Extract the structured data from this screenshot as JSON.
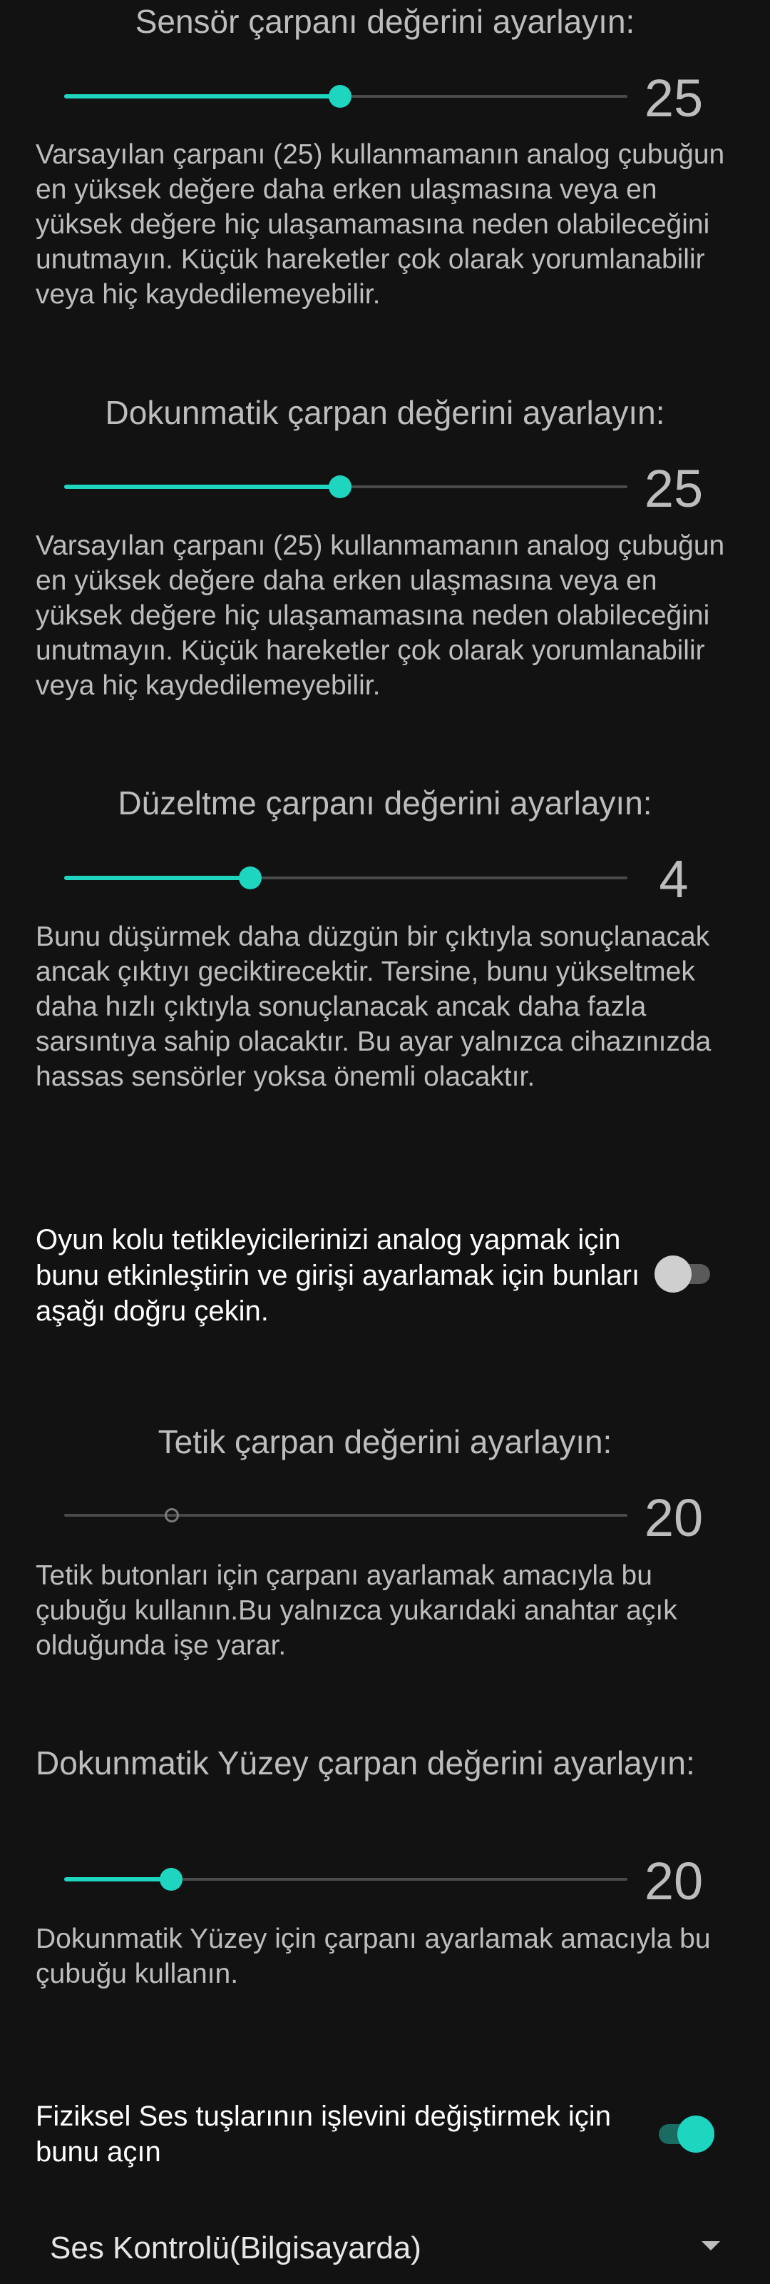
{
  "sensor_multiplier": {
    "title": "Sensör çarpanı değerini ayarlayın:",
    "value": "25",
    "slider_position": 0.49,
    "description": "Varsayılan çarpanı (25) kullanmamanın analog çubuğun en yüksek değere daha erken ulaşmasına veya en yüksek değere hiç ulaşamamasına neden olabileceğini unutmayın. Küçük hareketler çok olarak yorumlanabilir veya hiç kaydedilemeyebilir."
  },
  "touch_multiplier": {
    "title": "Dokunmatik çarpan değerini ayarlayın:",
    "value": "25",
    "slider_position": 0.49,
    "description": "Varsayılan çarpanı (25) kullanmamanın analog çubuğun en yüksek değere daha erken ulaşmasına veya en yüksek değere hiç ulaşamamasına neden olabileceğini unutmayın. Küçük hareketler çok olarak yorumlanabilir veya hiç kaydedilemeyebilir."
  },
  "smoothing_multiplier": {
    "title": "Düzeltme çarpanı değerini ayarlayın:",
    "value": "4",
    "slider_position": 0.33,
    "description": "Bunu düşürmek daha düzgün bir çıktıyla sonuçlanacak ancak çıktıyı geciktirecektir. Tersine, bunu yükseltmek daha hızlı çıktıyla sonuçlanacak ancak daha fazla sarsıntıya sahip olacaktır. Bu ayar yalnızca cihazınızda hassas sensörler yoksa önemli olacaktır."
  },
  "analog_triggers": {
    "label": "Oyun kolu tetikleyicilerinizi analog yapmak için bunu etkinleştirin ve girişi ayarlamak için bunları aşağı doğru çekin.",
    "enabled": false
  },
  "trigger_multiplier": {
    "title": "Tetik çarpan değerini ayarlayın:",
    "value": "20",
    "slider_position": 0.19,
    "enabled": false,
    "description": "Tetik butonları için çarpanı ayarlamak amacıyla bu çubuğu kullanın.Bu yalnızca yukarıdaki anahtar açık olduğunda işe yarar."
  },
  "touchpad_multiplier": {
    "title": "Dokunmatik Yüzey çarpan değerini ayarlayın:",
    "value": "20",
    "slider_position": 0.19,
    "description": "Dokunmatik Yüzey için çarpanı ayarlamak amacıyla bu çubuğu kullanın."
  },
  "volume_keys": {
    "label": "Fiziksel Ses tuşlarının işlevini değiştirmek için bunu açın",
    "enabled": true
  },
  "volume_mode": {
    "selected": "Ses Kontrolü(Bilgisayarda)"
  },
  "colors": {
    "accent": "#1ed6c0",
    "background": "#121212",
    "track": "#4a4a4a"
  }
}
